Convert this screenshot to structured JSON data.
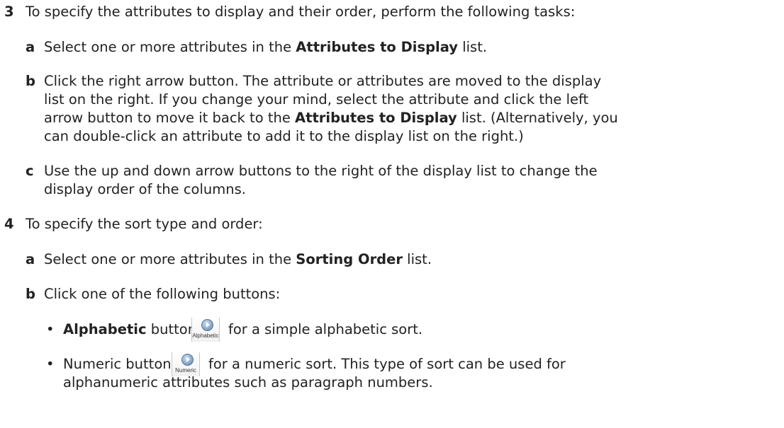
{
  "steps": [
    {
      "number": "3",
      "intro": "To specify the attributes to display and their order, perform the following tasks:",
      "substeps": [
        {
          "letter": "a",
          "lines": [
            {
              "pre": "Select one or more attributes in the ",
              "bold": "Attributes to Display",
              "post": " list."
            }
          ]
        },
        {
          "letter": "b",
          "lines": [
            {
              "text": "Click the right arrow button. The attribute or attributes are moved to the display"
            },
            {
              "text": "list on the right. If you change your mind, select the attribute and click the left"
            },
            {
              "pre": "arrow button to move it back to the ",
              "bold": "Attributes to Display",
              "post": " list. (Alternatively, you"
            },
            {
              "text": "can double-click an attribute to add it to the display list on the right.)"
            }
          ]
        },
        {
          "letter": "c",
          "lines": [
            {
              "text": "Use the up and down arrow buttons to the right of the display list to change the"
            },
            {
              "text": "display order of the columns."
            }
          ]
        }
      ]
    },
    {
      "number": "4",
      "intro": "To specify the sort type and order:",
      "substeps": [
        {
          "letter": "a",
          "lines": [
            {
              "pre": "Select one or more attributes in the ",
              "bold": "Sorting Order",
              "post": " list."
            }
          ]
        },
        {
          "letter": "b",
          "lines": [
            {
              "text": "Click one of the following buttons:"
            }
          ]
        }
      ],
      "bullets": [
        {
          "bold": "Alphabetic",
          "pre": " button",
          "icon_caption": "Alphabetic",
          "icon_name": "alphabetic-sort-icon",
          "post": "for a simple alphabetic sort."
        },
        {
          "bold": "",
          "pre": "Numeric button",
          "icon_caption": "Numeric",
          "icon_name": "numeric-sort-icon",
          "post": "for a numeric sort. This type of sort can be used for",
          "continuation": "alphanumeric attributes such as paragraph numbers."
        }
      ]
    }
  ]
}
